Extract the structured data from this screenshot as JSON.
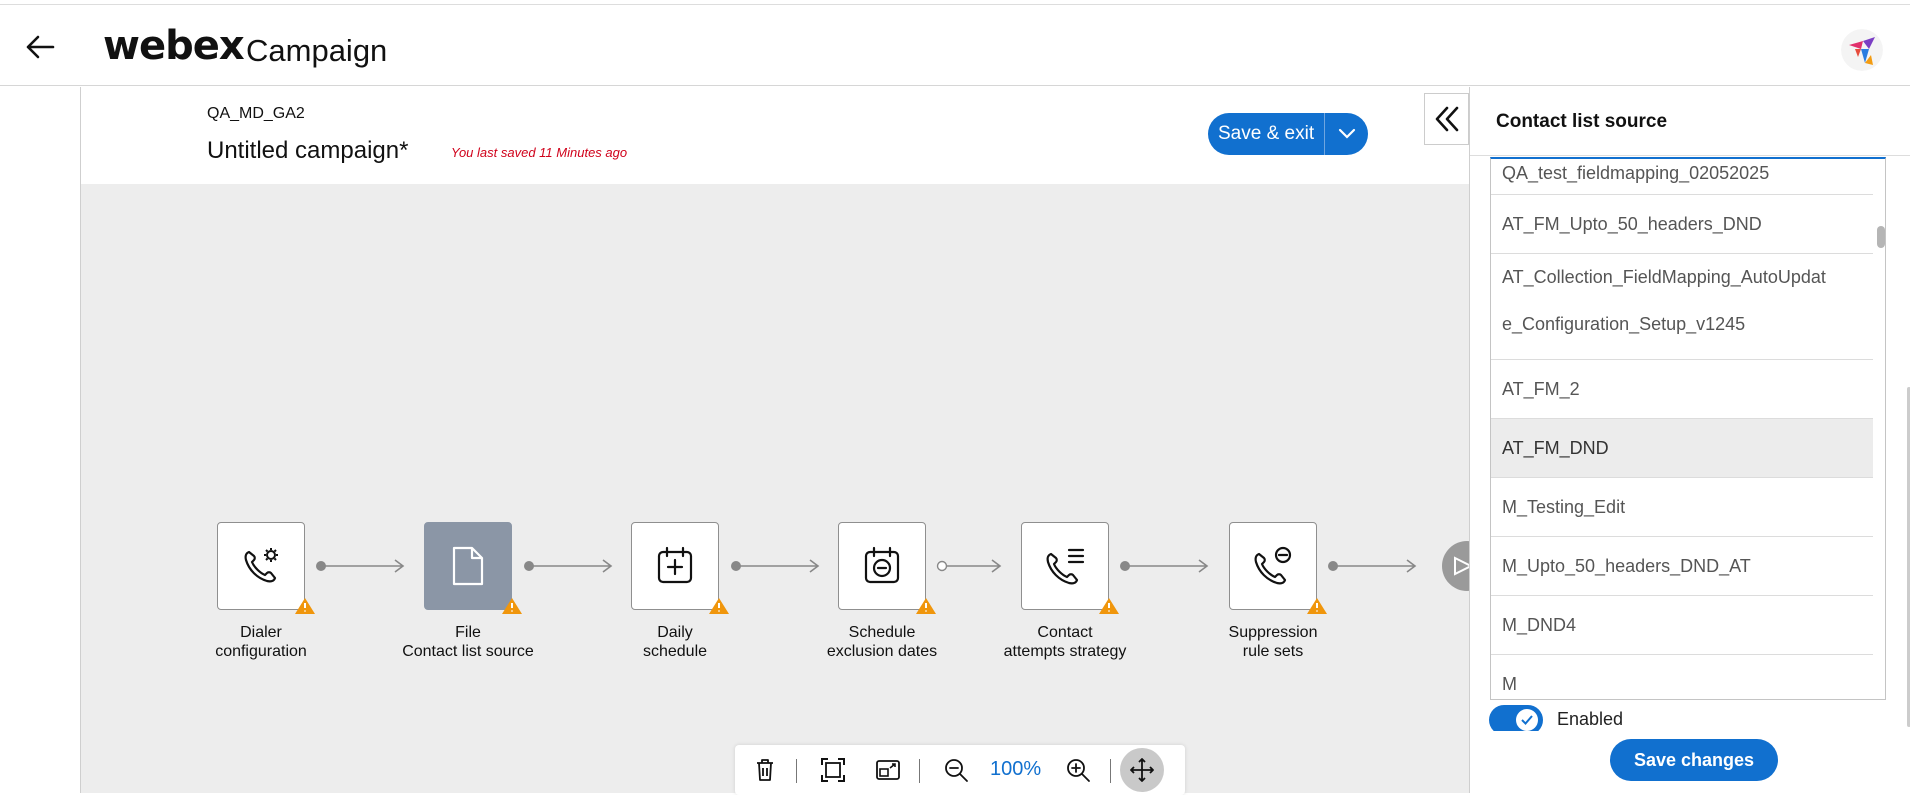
{
  "app": {
    "brand": "webex",
    "product": "Campaign"
  },
  "campaign": {
    "parent_name": "QA_MD_GA2",
    "title": "Untitled campaign*",
    "saved_note": "You last saved 11 Minutes ago",
    "save_exit_label": "Save & exit"
  },
  "flow": {
    "nodes": [
      {
        "line1": "Dialer",
        "line2": "configuration",
        "icon": "phone-settings-icon",
        "warning": true
      },
      {
        "line1": "File",
        "line2": "Contact list source",
        "icon": "file-icon",
        "warning": true,
        "active": true
      },
      {
        "line1": "Daily",
        "line2": "schedule",
        "icon": "calendar-add-icon",
        "warning": true
      },
      {
        "line1": "Schedule",
        "line2": "exclusion dates",
        "icon": "calendar-minus-icon",
        "warning": true
      },
      {
        "line1": "Contact",
        "line2": "attempts strategy",
        "icon": "phone-list-icon",
        "warning": true
      },
      {
        "line1": "Suppression",
        "line2": "rule sets",
        "icon": "phone-block-icon",
        "warning": true
      }
    ]
  },
  "toolbar": {
    "zoom_level": "100%"
  },
  "side_panel": {
    "title": "Contact list source",
    "options": [
      "QA_test_fieldmapping_02052025",
      "AT_FM_Upto_50_headers_DND",
      "AT_Collection_FieldMapping_AutoUpdat",
      "e_Configuration_Setup_v1245",
      "AT_FM_2",
      "AT_FM_DND",
      "M_Testing_Edit",
      "M_Upto_50_headers_DND_AT",
      "M_DND4",
      "M"
    ],
    "selected_option": "AT_FM_DND",
    "toggle_label": "Enabled",
    "save_changes_label": "Save changes"
  },
  "colors": {
    "accent": "#1170cf",
    "warning": "#f0960c",
    "saved_note": "#d0021b",
    "active_node": "#8b96a6"
  }
}
